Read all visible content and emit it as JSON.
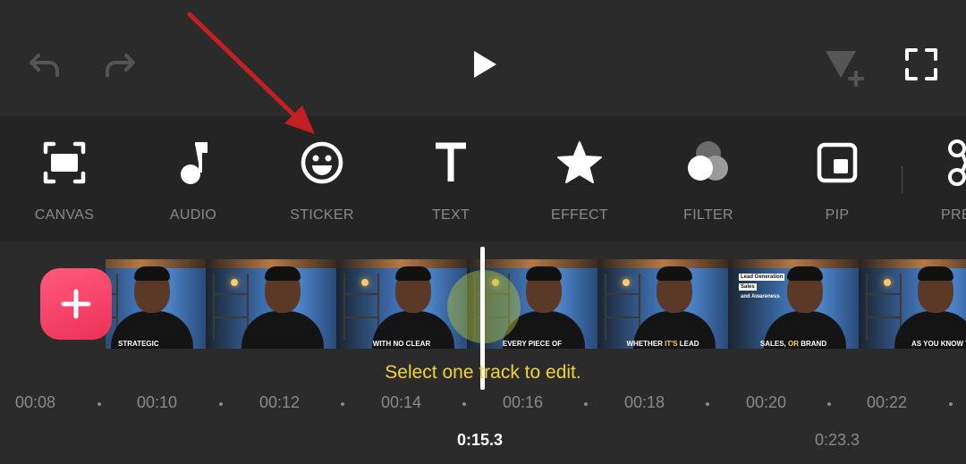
{
  "topbar": {
    "undo_icon": "undo-icon",
    "redo_icon": "redo-icon",
    "play_icon": "play-icon",
    "keyframe_icon": "add-keyframe-icon",
    "fullscreen_icon": "fullscreen-icon"
  },
  "tools": [
    {
      "label": "CANVAS",
      "icon": "canvas-icon"
    },
    {
      "label": "AUDIO",
      "icon": "music-note-icon"
    },
    {
      "label": "STICKER",
      "icon": "smiley-icon"
    },
    {
      "label": "TEXT",
      "icon": "text-icon"
    },
    {
      "label": "EFFECT",
      "icon": "star-icon"
    },
    {
      "label": "FILTER",
      "icon": "filter-circles-icon"
    },
    {
      "label": "PIP",
      "icon": "pip-icon"
    },
    {
      "label": "PRE",
      "icon": "precut-icon"
    }
  ],
  "timeline": {
    "add_icon": "plus-icon",
    "captions": [
      {
        "parts": [
          "STRATEGIC"
        ]
      },
      {
        "parts": []
      },
      {
        "parts": [
          "WITH NO CLEAR"
        ]
      },
      {
        "parts": [
          "EVERY PIECE OF"
        ]
      },
      {
        "parts": [
          "WHETHER ",
          "IT'S",
          " LEAD"
        ]
      },
      {
        "parts": [
          "SALES, ",
          "OR",
          " BRAND"
        ]
      },
      {
        "parts": [
          "AS YOU KNOW THAT"
        ]
      }
    ],
    "overlay_labels": [
      "Lead Generation",
      "Sales",
      "and Awareness"
    ],
    "hint": "Select one track to edit.",
    "ticks": [
      "00:08",
      "00:10",
      "00:12",
      "00:14",
      "00:16",
      "00:18",
      "00:20",
      "00:22"
    ],
    "current_time": "0:15.3",
    "total_time": "0:23.3"
  },
  "colors": {
    "background": "#2b2b2b",
    "toolbar": "#242424",
    "accent_add": "#ee3058",
    "hint": "#f2d43a",
    "arrow": "#c41f22"
  }
}
